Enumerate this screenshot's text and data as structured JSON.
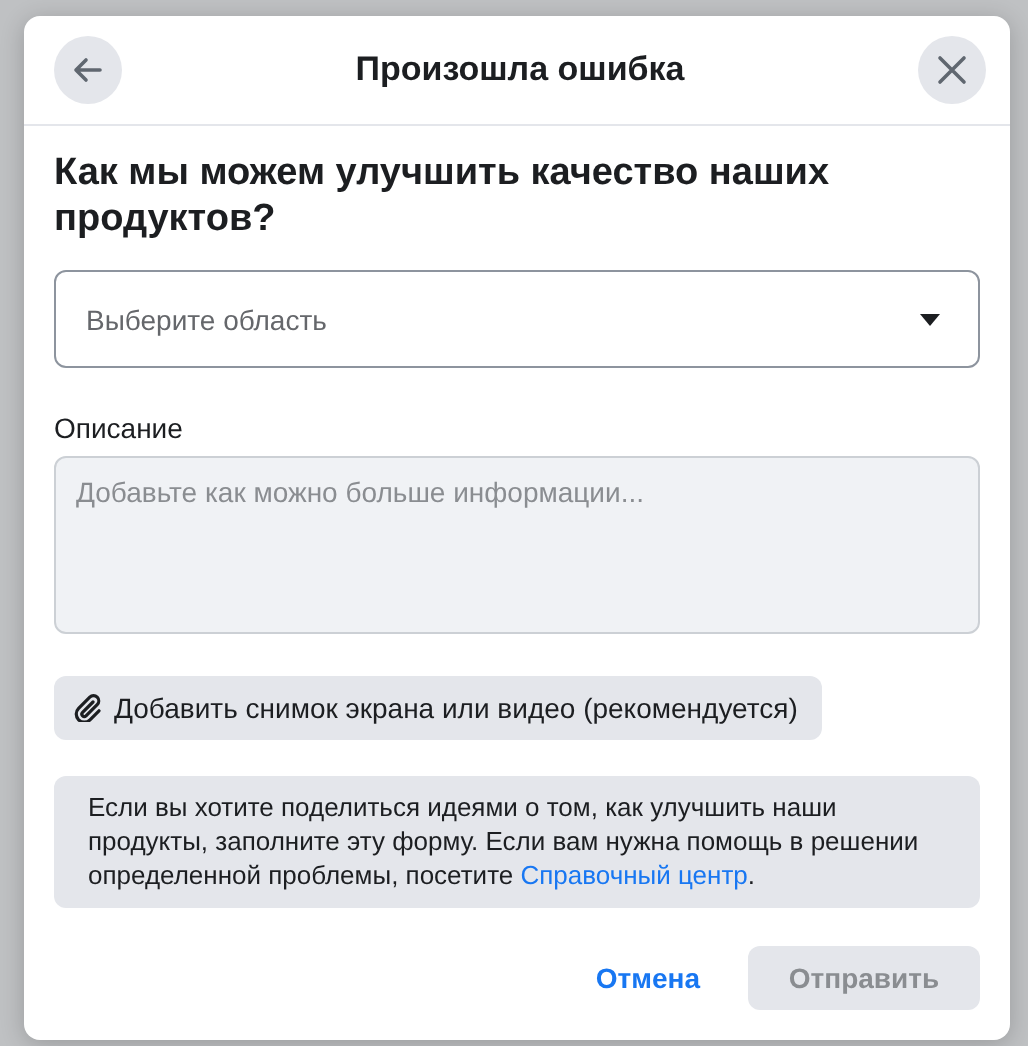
{
  "dialog": {
    "title": "Произошла ошибка"
  },
  "question": "Как мы можем улучшить качество наших продуктов?",
  "area_select": {
    "placeholder": "Выберите область"
  },
  "description": {
    "label": "Описание",
    "placeholder": "Добавьте как можно больше информации..."
  },
  "attach_button": "Добавить снимок экрана или видео (рекомендуется)",
  "info": {
    "text": "Если вы хотите поделиться идеями о том, как улучшить наши продукты, заполните эту форму. Если вам нужна помощь в решении определенной проблемы, посетите ",
    "link": "Справочный центр",
    "end": "."
  },
  "buttons": [
    {
      "label": "Отмена",
      "kind": "link",
      "disabled": false
    },
    {
      "label": "Отправить",
      "kind": "primary",
      "disabled": true
    }
  ]
}
